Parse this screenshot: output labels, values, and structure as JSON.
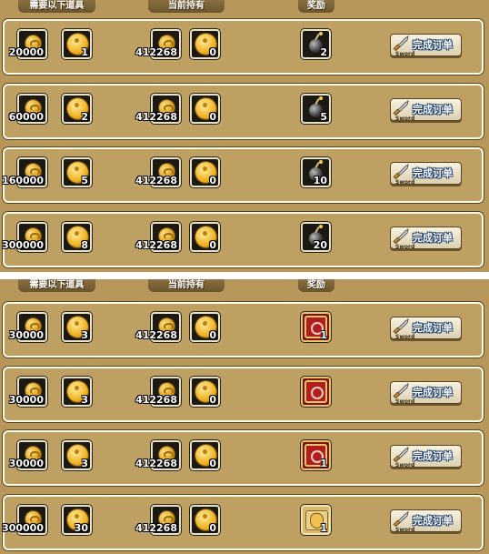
{
  "headers": {
    "required": "需要以下道具",
    "owned": "当前持有",
    "reward": "奖励"
  },
  "button": {
    "label": "完成订单",
    "sub": "Sword"
  },
  "colors": {
    "panel": "#b8985a",
    "row": "#bfa063",
    "slot": "#1c1812",
    "button_text_outline": "#1a3a6a"
  },
  "top_rows": [
    {
      "req_coin": "20000",
      "req_token": "1",
      "own_coin": "412268",
      "own_token": "0",
      "reward_icon": "bomb-icon",
      "reward_qty": "2"
    },
    {
      "req_coin": "60000",
      "req_token": "2",
      "own_coin": "412268",
      "own_token": "0",
      "reward_icon": "bomb-icon",
      "reward_qty": "5"
    },
    {
      "req_coin": "160000",
      "req_token": "5",
      "own_coin": "412268",
      "own_token": "0",
      "reward_icon": "bomb-icon",
      "reward_qty": "10"
    },
    {
      "req_coin": "300000",
      "req_token": "8",
      "own_coin": "412268",
      "own_token": "0",
      "reward_icon": "bomb-icon",
      "reward_qty": "20"
    }
  ],
  "bottom_rows": [
    {
      "req_coin": "30000",
      "req_token": "3",
      "own_coin": "412268",
      "own_token": "0",
      "reward_icon": "red-seal-icon",
      "reward_qty": "1"
    },
    {
      "req_coin": "30000",
      "req_token": "3",
      "own_coin": "412268",
      "own_token": "0",
      "reward_icon": "red-seal-icon",
      "reward_qty": ""
    },
    {
      "req_coin": "30000",
      "req_token": "3",
      "own_coin": "412268",
      "own_token": "0",
      "reward_icon": "red-seal-icon",
      "reward_qty": "1"
    },
    {
      "req_coin": "300000",
      "req_token": "30",
      "own_coin": "412268",
      "own_token": "0",
      "reward_icon": "scroll-bag-icon",
      "reward_qty": "1"
    }
  ]
}
